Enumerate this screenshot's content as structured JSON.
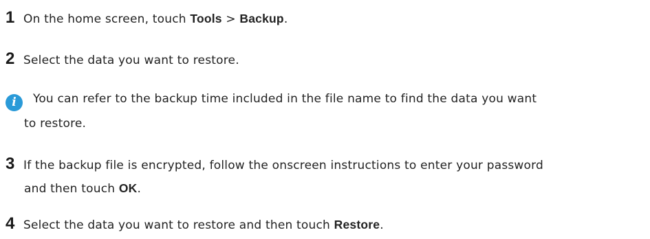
{
  "steps": [
    {
      "number": "1",
      "pre": "On the home screen, touch ",
      "b1": "Tools",
      "mid": " > ",
      "b2": "Backup",
      "post": "."
    },
    {
      "number": "2",
      "text": "Select the data you want to restore."
    },
    {
      "number": "3",
      "line1": "If the backup file is encrypted, follow the onscreen instructions to enter your password",
      "line2_pre": "and then touch ",
      "b1": "OK",
      "post": "."
    },
    {
      "number": "4",
      "pre": "Select the data you want to restore and then touch ",
      "b1": "Restore",
      "post": "."
    }
  ],
  "note": {
    "icon": "info-icon",
    "line1": "You can refer to the backup time included in the file name to find the data you want",
    "line2": "to restore."
  },
  "colors": {
    "accent": "#2a9ad8",
    "text": "#222222"
  }
}
